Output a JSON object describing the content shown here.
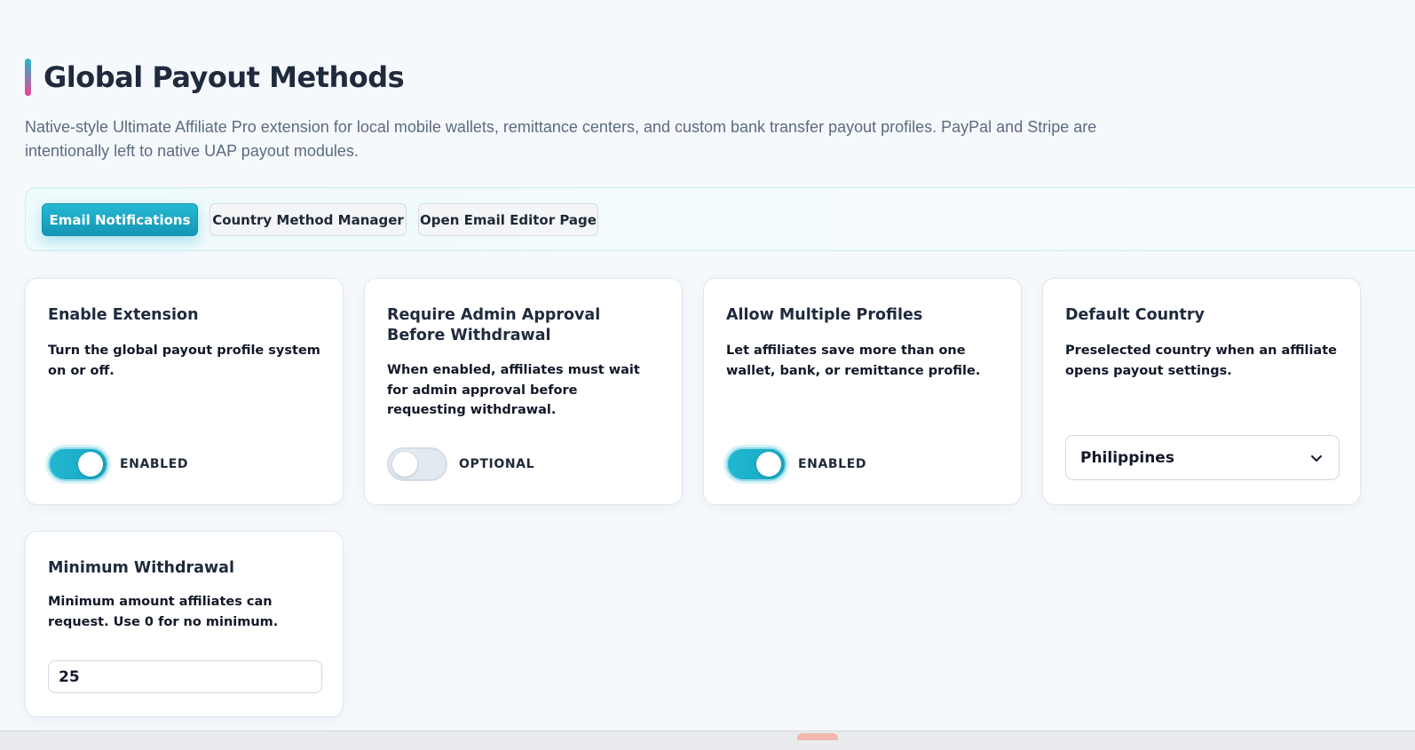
{
  "header": {
    "title": "Global Payout Methods",
    "description": "Native-style Ultimate Affiliate Pro extension for local mobile wallets, remittance centers, and custom bank transfer payout profiles. PayPal and Stripe are intentionally left to native UAP payout modules."
  },
  "tabs": [
    {
      "label": "Email Notifications",
      "active": true
    },
    {
      "label": "Country Method Manager",
      "active": false
    },
    {
      "label": "Open Email Editor Page",
      "active": false
    }
  ],
  "settings": {
    "enable_extension": {
      "title": "Enable Extension",
      "description": "Turn the global payout profile system on or off.",
      "state": "ENABLED",
      "on": true
    },
    "require_approval": {
      "title": "Require Admin Approval Before Withdrawal",
      "description": "When enabled, affiliates must wait for admin approval before requesting withdrawal.",
      "state": "OPTIONAL",
      "on": false
    },
    "multiple_profiles": {
      "title": "Allow Multiple Profiles",
      "description": "Let affiliates save more than one wallet, bank, or remittance profile.",
      "state": "ENABLED",
      "on": true
    },
    "default_country": {
      "title": "Default Country",
      "description": "Preselected country when an affiliate opens payout settings.",
      "selected": "Philippines"
    },
    "minimum_withdrawal": {
      "title": "Minimum Withdrawal",
      "description": "Minimum amount affiliates can request. Use 0 for no minimum.",
      "value": "25"
    }
  },
  "icons": {
    "select_chevron": "chevron-down-icon"
  },
  "colors": {
    "accent": "#22b8cf",
    "accent_dark": "#1596b4",
    "title_bar_bottom": "#e84393",
    "background": "#f6f9fc"
  }
}
